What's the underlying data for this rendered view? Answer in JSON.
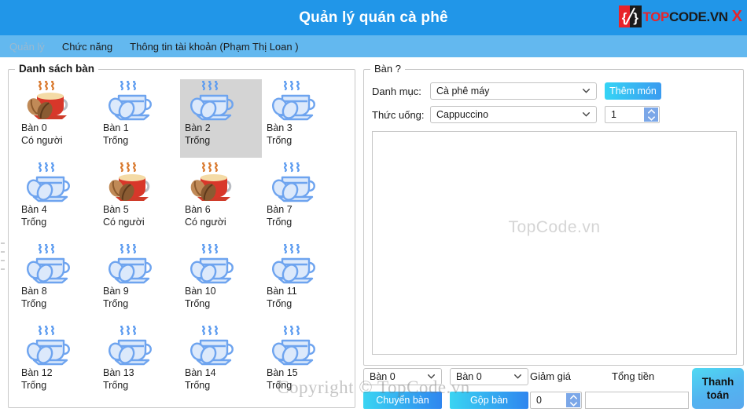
{
  "window": {
    "title": "Quản lý quán cà phê",
    "logo": {
      "top": "TOP",
      "code": "CODE",
      "vn": ".VN",
      "close": "X",
      "badge_icon": "topcode-brackets-icon"
    }
  },
  "menubar": {
    "items": [
      {
        "label": "Quản lý",
        "disabled": true
      },
      {
        "label": "Chức năng",
        "disabled": false
      },
      {
        "label": "Thông tin tài khoản (Phạm Thị Loan )",
        "disabled": false
      }
    ]
  },
  "tables_panel": {
    "legend": "Danh sách bàn",
    "status_occupied": "Có người",
    "status_empty": "Trống",
    "tables": [
      {
        "name": "Bàn 0",
        "status": "Có người",
        "occupied": true,
        "selected": false
      },
      {
        "name": "Bàn 1",
        "status": "Trống",
        "occupied": false,
        "selected": false
      },
      {
        "name": "Bàn 2",
        "status": "Trống",
        "occupied": false,
        "selected": true
      },
      {
        "name": "Bàn 3",
        "status": "Trống",
        "occupied": false,
        "selected": false
      },
      {
        "name": "Bàn 4",
        "status": "Trống",
        "occupied": false,
        "selected": false
      },
      {
        "name": "Bàn 5",
        "status": "Có người",
        "occupied": true,
        "selected": false
      },
      {
        "name": "Bàn 6",
        "status": "Có người",
        "occupied": true,
        "selected": false
      },
      {
        "name": "Bàn 7",
        "status": "Trống",
        "occupied": false,
        "selected": false
      },
      {
        "name": "Bàn 8",
        "status": "Trống",
        "occupied": false,
        "selected": false
      },
      {
        "name": "Bàn 9",
        "status": "Trống",
        "occupied": false,
        "selected": false
      },
      {
        "name": "Bàn 10",
        "status": "Trống",
        "occupied": false,
        "selected": false
      },
      {
        "name": "Bàn 11",
        "status": "Trống",
        "occupied": false,
        "selected": false
      },
      {
        "name": "Bàn 12",
        "status": "Trống",
        "occupied": false,
        "selected": false
      },
      {
        "name": "Bàn 13",
        "status": "Trống",
        "occupied": false,
        "selected": false
      },
      {
        "name": "Bàn 14",
        "status": "Trống",
        "occupied": false,
        "selected": false
      },
      {
        "name": "Bàn 15",
        "status": "Trống",
        "occupied": false,
        "selected": false
      }
    ]
  },
  "order_panel": {
    "legend": "Bàn ?",
    "category_label": "Danh mục:",
    "category_value": "Cà phê máy",
    "drink_label": "Thức uống:",
    "drink_value": "Cappuccino",
    "add_button": "Thêm món",
    "quantity_value": "1",
    "list_watermark": "TopCode.vn",
    "list_items": []
  },
  "bottom_bar": {
    "move_from_value": "Bàn 0",
    "move_to_value": "Bàn 0",
    "move_button": "Chuyển bàn",
    "merge_button": "Gộp bàn",
    "discount_label": "Giảm giá",
    "discount_value": "0",
    "total_label": "Tổng tiền",
    "total_value": "",
    "pay_button_line1": "Thanh",
    "pay_button_line2": "toán"
  },
  "watermark": {
    "copyright": "Copyright © TopCode.vn"
  },
  "colors": {
    "titlebar": "#2196e8",
    "menubar": "#63b8ef",
    "accent_cyan": "#35d4f5",
    "accent_blue": "#3a9bf0",
    "selection": "#d4d4d4",
    "brand_red": "#e8232a"
  }
}
